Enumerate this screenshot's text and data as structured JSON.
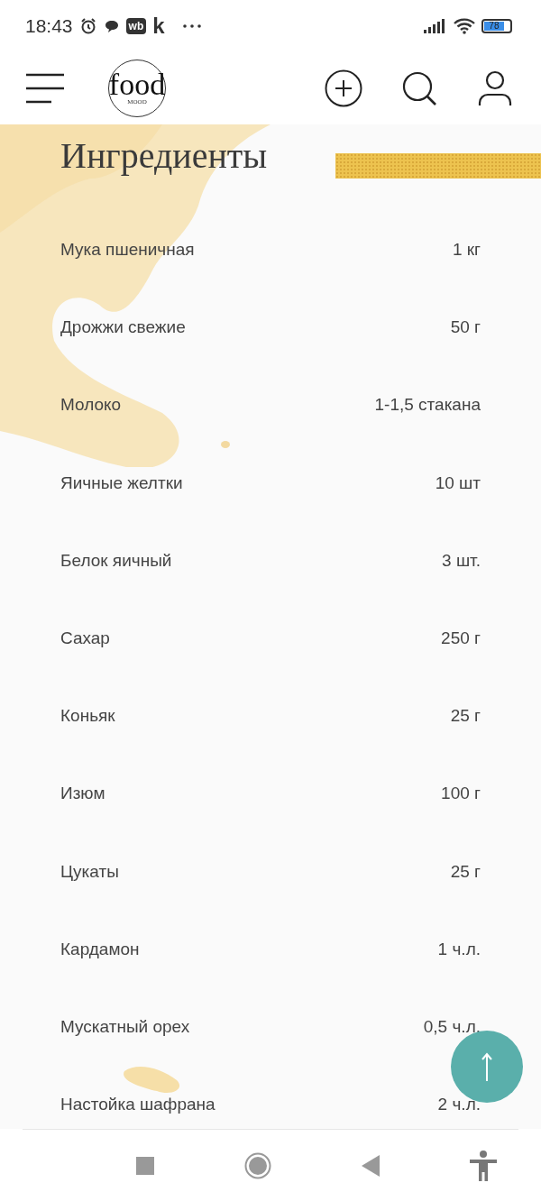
{
  "status_bar": {
    "time": "18:43",
    "app_badges": [
      "wb",
      "k"
    ],
    "battery": "78"
  },
  "header": {
    "logo": {
      "word": "food",
      "subword": "MOOD"
    }
  },
  "section": {
    "title": "Ингредиенты"
  },
  "ingredients": [
    {
      "name": "Мука пшеничная",
      "amount": "1 кг"
    },
    {
      "name": "Дрожжи свежие",
      "amount": "50 г"
    },
    {
      "name": "Молоко",
      "amount": "1-1,5 стакана"
    },
    {
      "name": "Яичные желтки",
      "amount": "10 шт"
    },
    {
      "name": "Белок яичный",
      "amount": "3 шт."
    },
    {
      "name": "Сахар",
      "amount": "250 г"
    },
    {
      "name": "Коньяк",
      "amount": "25 г"
    },
    {
      "name": "Изюм",
      "amount": "100 г"
    },
    {
      "name": "Цукаты",
      "amount": "25 г"
    },
    {
      "name": "Кардамон",
      "amount": "1 ч.л."
    },
    {
      "name": "Мускатный орех",
      "amount": "0,5 ч.л."
    },
    {
      "name": "Настойка шафрана",
      "amount": "2 ч.л."
    }
  ]
}
